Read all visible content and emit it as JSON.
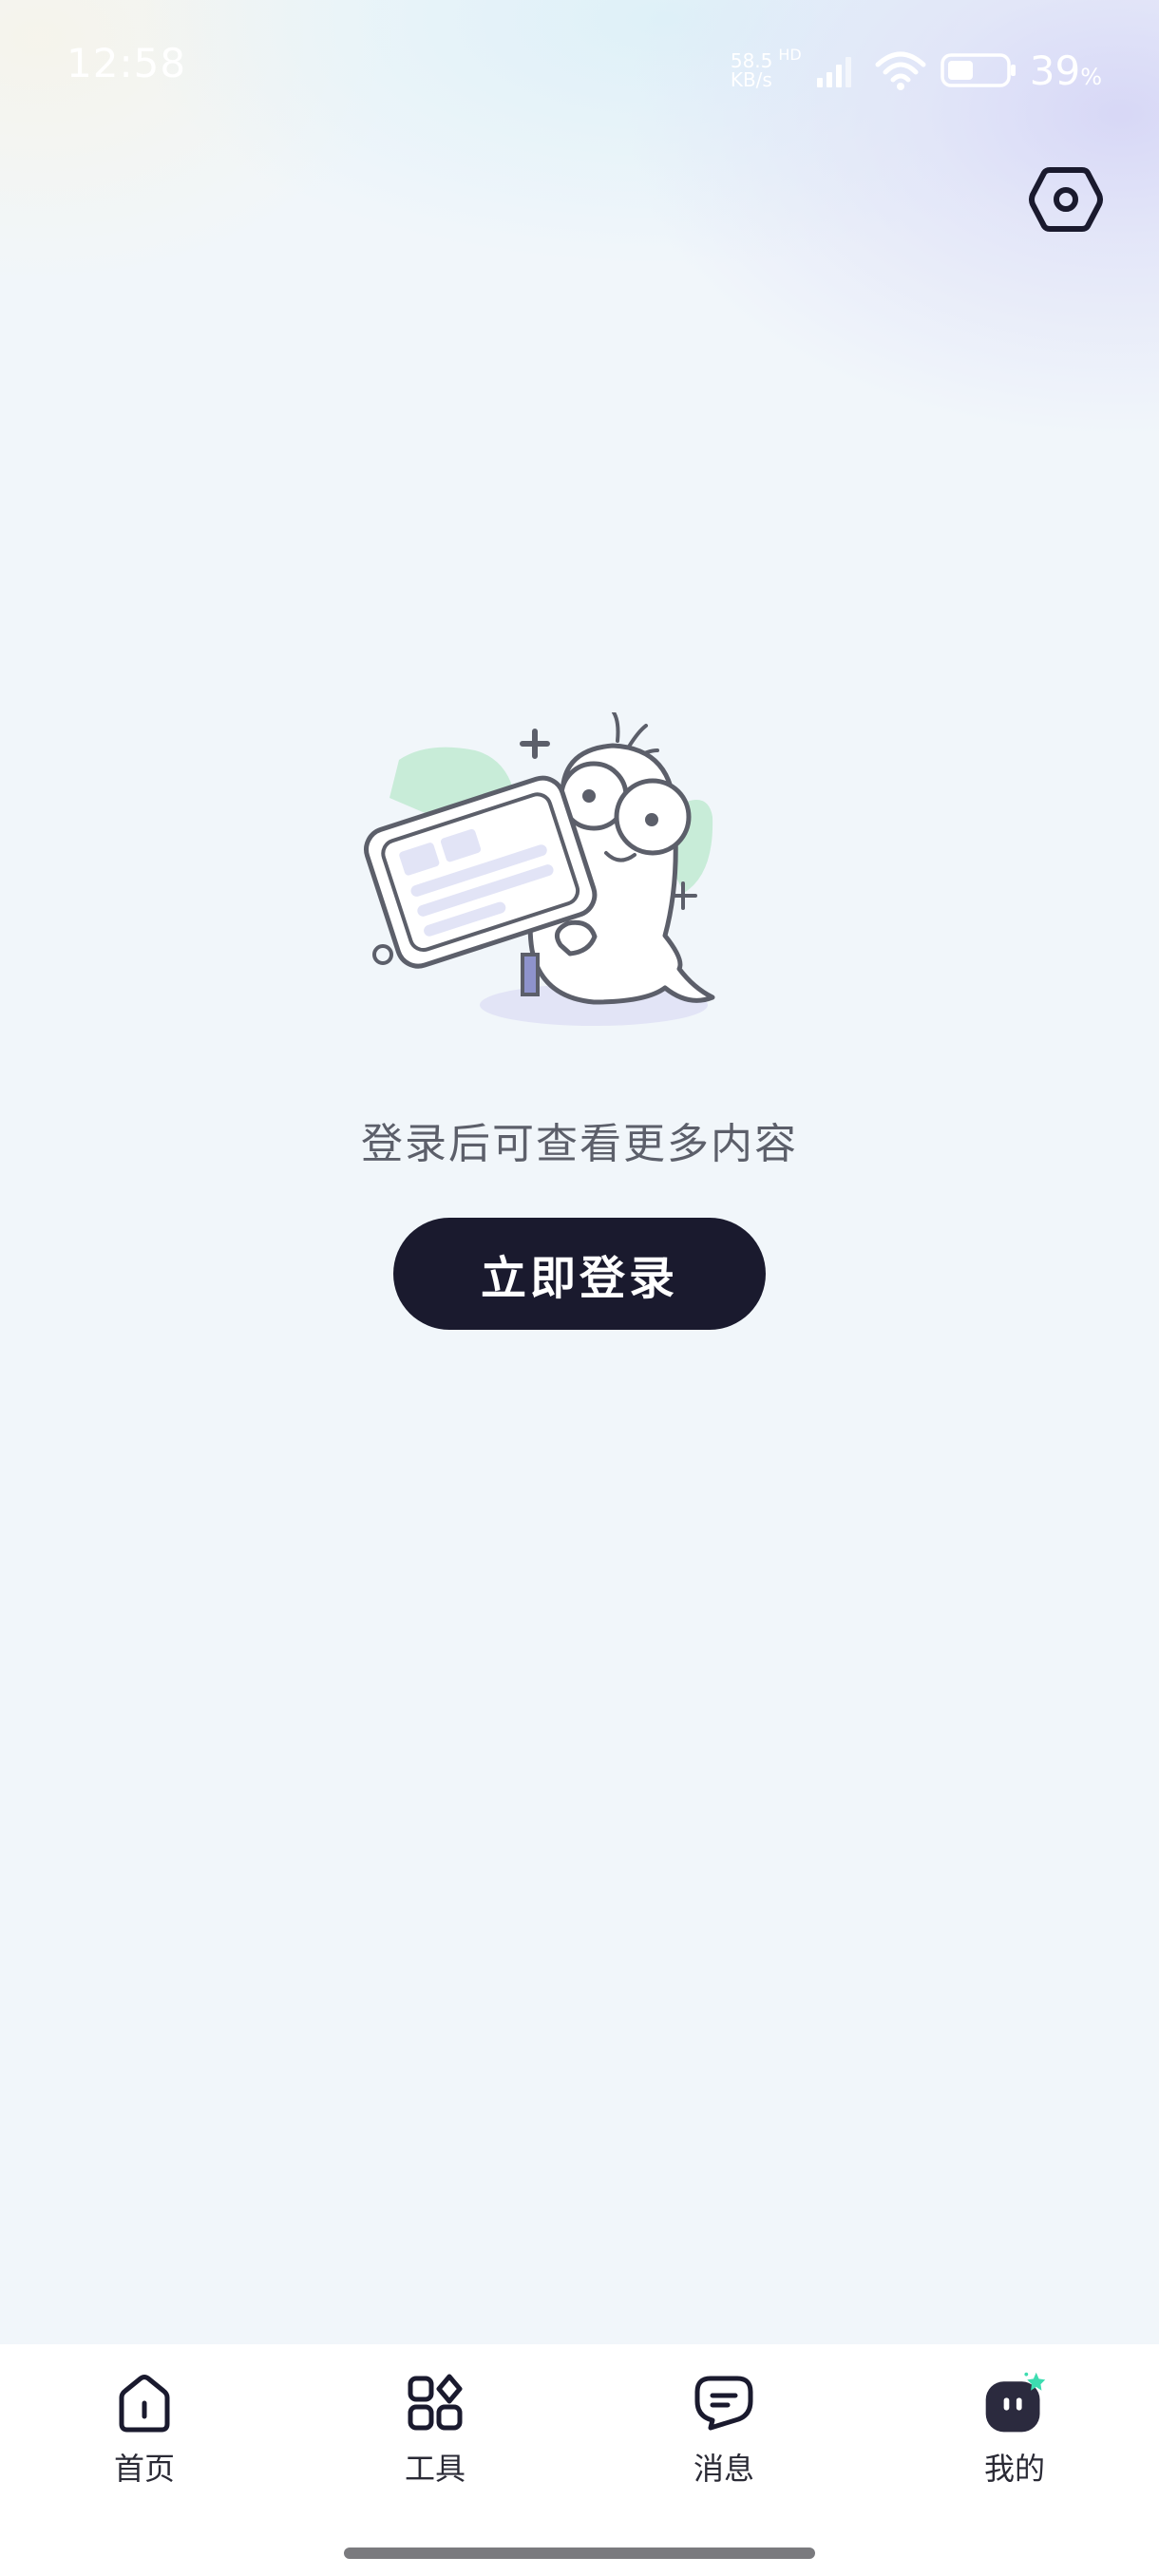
{
  "status_bar": {
    "time": "12:58",
    "net_speed_value": "58.5",
    "net_speed_unit": "KB/s",
    "network_type": "HD",
    "battery_level": "39",
    "battery_unit": "%"
  },
  "header": {
    "settings_icon": "settings-hexagon-icon"
  },
  "empty_state": {
    "illustration": "mascot-with-card",
    "message": "登录后可查看更多内容",
    "login_button_label": "立即登录"
  },
  "tab_bar": {
    "tabs": [
      {
        "label": "首页",
        "icon": "home-icon"
      },
      {
        "label": "工具",
        "icon": "tools-grid-icon"
      },
      {
        "label": "消息",
        "icon": "message-icon"
      },
      {
        "label": "我的",
        "icon": "profile-avatar-icon"
      }
    ],
    "active_index": 3
  },
  "colors": {
    "background": "#f1f6fa",
    "primary_button": "#1a1a2e",
    "accent": "#3ddcb0",
    "illustration_green": "#c8ecd8",
    "illustration_lavender": "#e2e4f6"
  }
}
